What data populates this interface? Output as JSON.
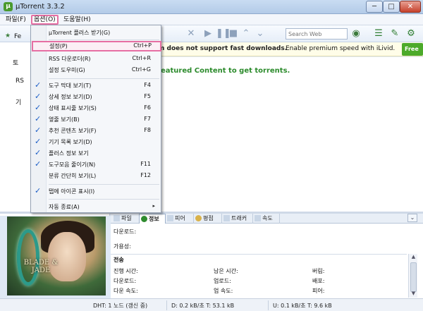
{
  "window": {
    "title": "µTorrent 3.3.2",
    "app_icon": "µ",
    "minimize": "─",
    "maximize": "□",
    "close": "✕"
  },
  "menubar": {
    "items": [
      "파일(F)",
      "옵션(O)",
      "도움말(H)"
    ]
  },
  "toolbar": {
    "search_placeholder": "Search Web"
  },
  "sidebar": {
    "feed_label": "Fe",
    "torrents_label": "토",
    "rss_label": "RS",
    "devices_label": "기"
  },
  "banner": {
    "bold_text": "m does not support fast downloads.",
    "rest_text": "Enable premium speed with iLivid.",
    "free_button": "Free"
  },
  "main": {
    "featured_text": "eatured Content to get torrents."
  },
  "preview": {
    "logo_text": "BLADE & JADE"
  },
  "dropdown": {
    "items": [
      {
        "label": "µTorrent 플러스 받기(G)",
        "shortcut": "",
        "checked": false
      },
      {
        "label": "설정(P)",
        "shortcut": "Ctrl+P",
        "checked": false
      },
      {
        "label": "RSS 다운로더(R)",
        "shortcut": "Ctrl+R",
        "checked": false
      },
      {
        "label": "설정 도우미(G)",
        "shortcut": "Ctrl+G",
        "checked": false
      },
      {
        "label": "도구 막대 보기(T)",
        "shortcut": "F4",
        "checked": true
      },
      {
        "label": "상세 정보 보기(D)",
        "shortcut": "F5",
        "checked": true
      },
      {
        "label": "상태 표시줄 보기(S)",
        "shortcut": "F6",
        "checked": true
      },
      {
        "label": "옆줄 보기(B)",
        "shortcut": "F7",
        "checked": true
      },
      {
        "label": "추천 콘텐츠 보기(F)",
        "shortcut": "F8",
        "checked": true
      },
      {
        "label": "기기 목록 보기(D)",
        "shortcut": "",
        "checked": true
      },
      {
        "label": "플러스 정보 보기",
        "shortcut": "",
        "checked": true
      },
      {
        "label": "도구모음 줄이기(N)",
        "shortcut": "F11",
        "checked": true
      },
      {
        "label": "분류 간단히 보기(L)",
        "shortcut": "F12",
        "checked": false
      },
      {
        "label": "탭에 아이콘 표시(I)",
        "shortcut": "",
        "checked": true
      },
      {
        "label": "자동 종료(A)",
        "shortcut": "",
        "checked": false,
        "submenu": "▸"
      }
    ],
    "check_mark": "✓"
  },
  "tabs": [
    "파일",
    "정보",
    "피어",
    "평점",
    "트래커",
    "속도"
  ],
  "collapse_icon": "⌄",
  "info": {
    "download_label": "다운로드:",
    "availability_label": "가용성:",
    "transfer_header": "전송",
    "rows": [
      [
        "진행 시간:",
        "남은 시간:",
        "버림:"
      ],
      [
        "다운로드:",
        "업로드:",
        "배포:"
      ],
      [
        "다운 속도:",
        "업 속도:",
        "피어:"
      ]
    ]
  },
  "status": {
    "dht": "DHT: 1 노드  (갱신 중)",
    "down": "D: 0.2 kB/초 T: 53.1 kB",
    "up": "U: 0.1 kB/초 T: 9.6 kB"
  },
  "colors": {
    "highlight_border": "#e66fa3",
    "check": "#1d5fc7",
    "featured": "#2c8b2c",
    "free_button": "#4caa2a"
  }
}
